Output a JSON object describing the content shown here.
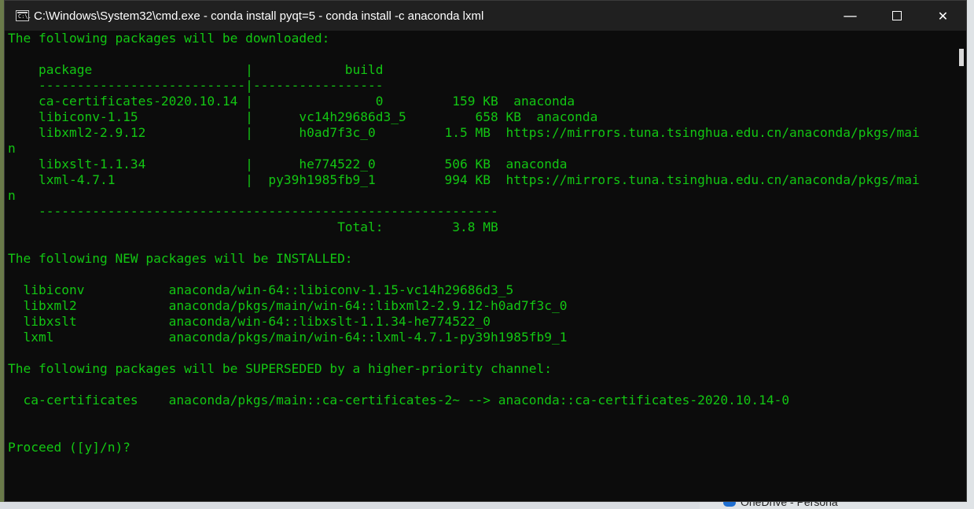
{
  "window": {
    "title": "C:\\Windows\\System32\\cmd.exe - conda  install pyqt=5 - conda  install -c anaconda lxml",
    "icon_label": "C:\\.",
    "controls": {
      "minimize": "—",
      "maximize": "☐",
      "close": "✕"
    }
  },
  "console": {
    "lines": [
      "The following packages will be downloaded:",
      "",
      "    package                    |            build",
      "    ---------------------------|-----------------",
      "    ca-certificates-2020.10.14 |                0         159 KB  anaconda",
      "    libiconv-1.15              |      vc14h29686d3_5         658 KB  anaconda",
      "    libxml2-2.9.12             |      h0ad7f3c_0         1.5 MB  https://mirrors.tuna.tsinghua.edu.cn/anaconda/pkgs/mai",
      "n",
      "    libxslt-1.1.34             |      he774522_0         506 KB  anaconda",
      "    lxml-4.7.1                 |  py39h1985fb9_1         994 KB  https://mirrors.tuna.tsinghua.edu.cn/anaconda/pkgs/mai",
      "n",
      "    ------------------------------------------------------------",
      "                                           Total:         3.8 MB",
      "",
      "The following NEW packages will be INSTALLED:",
      "",
      "  libiconv           anaconda/win-64::libiconv-1.15-vc14h29686d3_5",
      "  libxml2            anaconda/pkgs/main/win-64::libxml2-2.9.12-h0ad7f3c_0",
      "  libxslt            anaconda/win-64::libxslt-1.1.34-he774522_0",
      "  lxml               anaconda/pkgs/main/win-64::lxml-4.7.1-py39h1985fb9_1",
      "",
      "The following packages will be SUPERSEDED by a higher-priority channel:",
      "",
      "  ca-certificates    anaconda/pkgs/main::ca-certificates-2~ --> anaconda::ca-certificates-2020.10.14-0",
      "",
      "",
      "Proceed ([y]/n)?"
    ]
  },
  "taskbar": {
    "onedrive_label": "OneDrive - Persona"
  },
  "colors": {
    "console_text": "#13c613",
    "console_bg": "#0c0c0c",
    "titlebar_bg": "#202020"
  }
}
